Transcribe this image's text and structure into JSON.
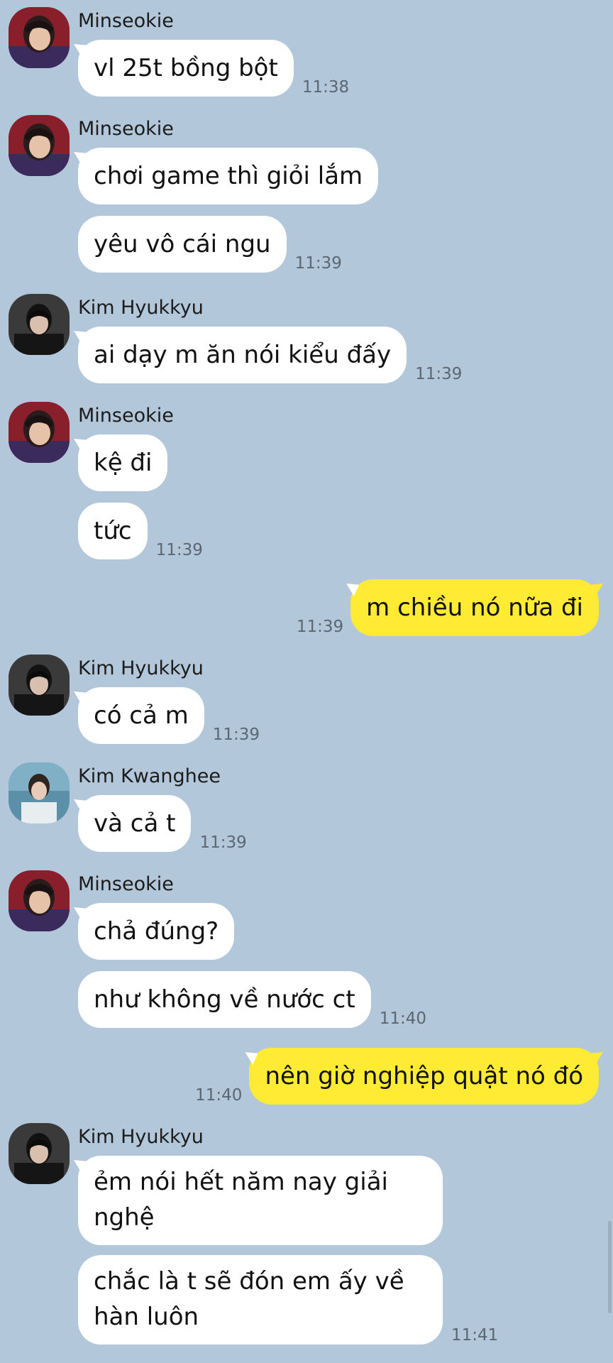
{
  "groups": [
    {
      "sender": "Minseokie",
      "avatar": "minseokie-avatar",
      "messages": [
        {
          "text": "vl 25t bồng bột",
          "time": "11:38"
        }
      ]
    },
    {
      "sender": "Minseokie",
      "avatar": "minseokie-avatar",
      "messages": [
        {
          "text": "chơi game thì giỏi lắm",
          "time": ""
        },
        {
          "text": "yêu vô cái ngu",
          "time": "11:39"
        }
      ]
    },
    {
      "sender": "Kim Hyukkyu",
      "avatar": "hyukkyu-avatar",
      "messages": [
        {
          "text": "ai dạy m ăn nói kiểu đấy",
          "time": "11:39"
        }
      ]
    },
    {
      "sender": "Minseokie",
      "avatar": "minseokie-avatar",
      "messages": [
        {
          "text": "kệ đi",
          "time": ""
        },
        {
          "text": "tức",
          "time": "11:39"
        }
      ]
    },
    {
      "mine": true,
      "messages": [
        {
          "text": "m chiều nó nữa đi",
          "time": "11:39"
        }
      ]
    },
    {
      "sender": "Kim Hyukkyu",
      "avatar": "hyukkyu-avatar",
      "messages": [
        {
          "text": "có cả m",
          "time": "11:39"
        }
      ]
    },
    {
      "sender": "Kim Kwanghee",
      "avatar": "kwanghee-avatar",
      "messages": [
        {
          "text": "và cả t",
          "time": "11:39"
        }
      ]
    },
    {
      "sender": "Minseokie",
      "avatar": "minseokie-avatar",
      "messages": [
        {
          "text": "chả đúng?",
          "time": ""
        },
        {
          "text": "như không về nước ct",
          "time": "11:40"
        }
      ]
    },
    {
      "mine": true,
      "messages": [
        {
          "text": "nên giờ nghiệp quật nó đó",
          "time": "11:40"
        }
      ]
    },
    {
      "sender": "Kim Hyukkyu",
      "avatar": "hyukkyu-avatar",
      "messages": [
        {
          "text": "ẻm nói hết năm nay giải nghệ",
          "time": ""
        },
        {
          "text": "chắc là t sẽ đón em ấy về hàn luôn",
          "time": "11:41"
        }
      ]
    }
  ],
  "colors": {
    "background": "#b2c7da",
    "incoming_bubble": "#ffffff",
    "outgoing_bubble": "#ffeb33",
    "time_text": "#5b6772"
  }
}
